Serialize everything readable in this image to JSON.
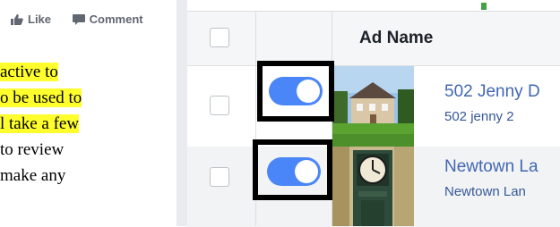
{
  "post_actions": {
    "like_label": "Like",
    "comment_label": "Comment"
  },
  "article_lines": [
    {
      "text": "active to",
      "highlight": true
    },
    {
      "text": "o be used to",
      "highlight": true
    },
    {
      "text": "l take a few",
      "highlight": true
    },
    {
      "text": "to review",
      "highlight": false
    },
    {
      "text": "make any",
      "highlight": false
    }
  ],
  "table": {
    "header": {
      "title": "Ad Name"
    },
    "rows": [
      {
        "name": "502 Jenny D",
        "sub": "502 jenny 2",
        "toggle_on": true,
        "thumb": "house-photo"
      },
      {
        "name": "Newtown La",
        "sub": "Newtown Lan",
        "toggle_on": true,
        "thumb": "clock-tower-photo"
      }
    ]
  },
  "colors": {
    "toggle_on": "#4a86f7",
    "highlight": "#ffff2e",
    "link": "#4267b2"
  }
}
